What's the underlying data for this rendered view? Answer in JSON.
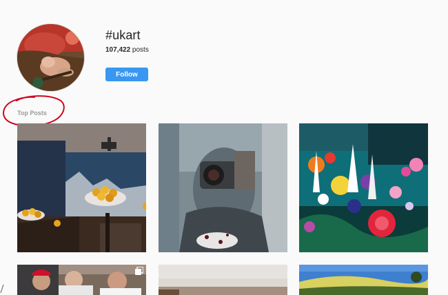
{
  "header": {
    "hashtag": "#ukart",
    "post_count": "107,422",
    "post_count_suffix": " posts",
    "follow_label": "Follow"
  },
  "sections": {
    "top_posts_label": "Top Posts"
  },
  "colors": {
    "accent": "#3897f0",
    "annotation": "#d0021b",
    "background": "#fafafa"
  },
  "posts": [
    {
      "subject": "still-life painting with oranges"
    },
    {
      "subject": "abstract photo of person with camera"
    },
    {
      "subject": "colorful floral abstract painting"
    },
    {
      "subject": "photo of three men, multi-post"
    },
    {
      "subject": "painting on wall"
    },
    {
      "subject": "landscape painting"
    }
  ]
}
